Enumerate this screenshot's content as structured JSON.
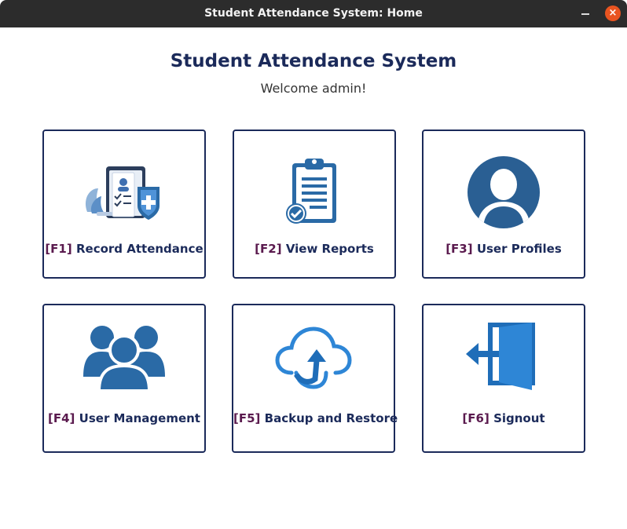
{
  "window": {
    "title": "Student Attendance System: Home",
    "minimize_icon": "minimize-icon",
    "close_icon": "close-icon",
    "close_glyph": "×"
  },
  "header": {
    "title": "Student Attendance System",
    "welcome": "Welcome admin!"
  },
  "tiles": [
    {
      "key": "[F1]",
      "label": "Record Attendance",
      "icon": "attendance-record-icon"
    },
    {
      "key": "[F2]",
      "label": "View Reports",
      "icon": "clipboard-report-icon"
    },
    {
      "key": "[F3]",
      "label": "User Profiles",
      "icon": "user-profile-icon"
    },
    {
      "key": "[F4]",
      "label": "User Management",
      "icon": "user-group-icon"
    },
    {
      "key": "[F5]",
      "label": "Backup and Restore",
      "icon": "cloud-upload-icon"
    },
    {
      "key": "[F6]",
      "label": "Signout",
      "icon": "signout-door-icon"
    }
  ],
  "colors": {
    "titlebar": "#2c2c2c",
    "close_button": "#e95420",
    "heading": "#1b2a5a",
    "key_accent": "#5a1a4e",
    "icon_blue": "#2a6aa6",
    "icon_light_blue": "#2e86d6"
  }
}
